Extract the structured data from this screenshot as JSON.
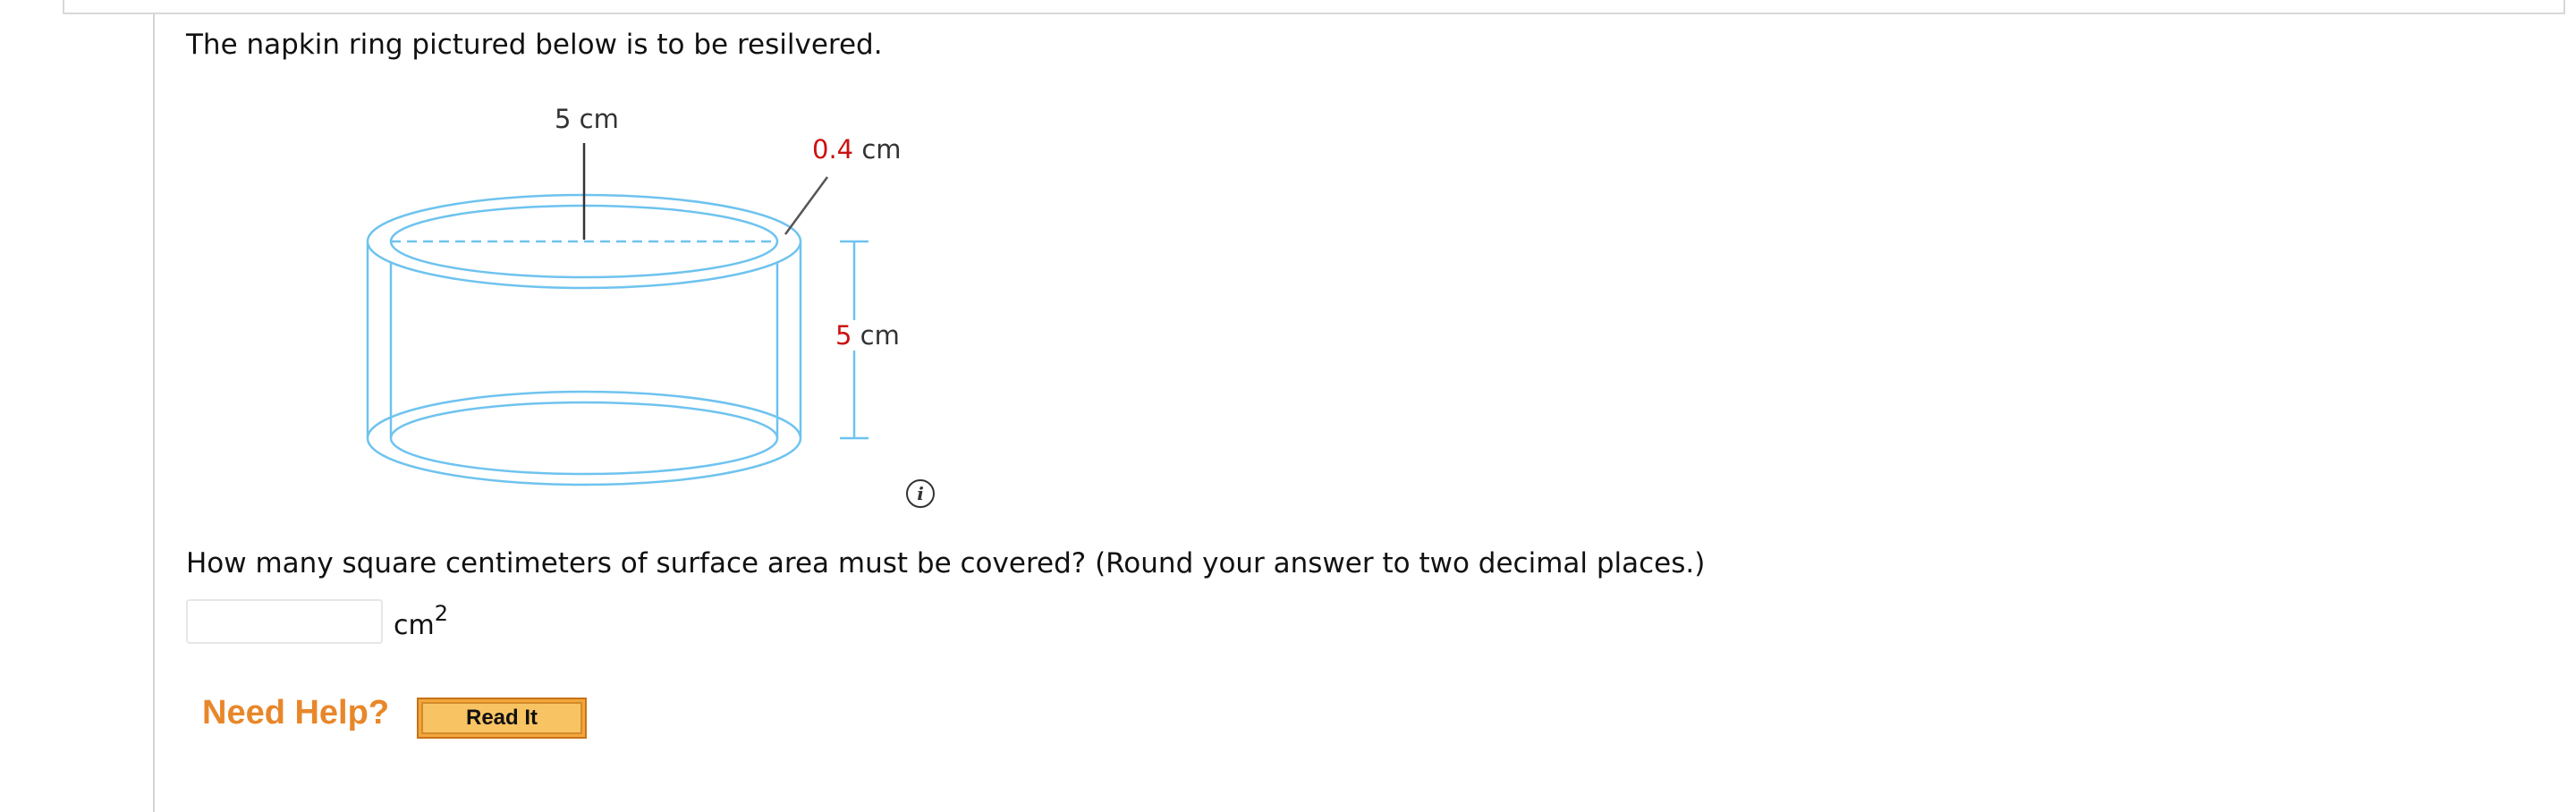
{
  "question": {
    "intro": "The napkin ring pictured below is to be resilvered.",
    "prompt": "How many square centimeters of surface area must be covered? (Round your answer to two decimal places.)"
  },
  "figure": {
    "diameter_label": "5 cm",
    "thickness_value": "0.4",
    "thickness_unit": " cm",
    "height_value": "5",
    "height_unit": " cm",
    "ring_color": "#6ec3ef",
    "value_color": "#cc1111",
    "info_icon": "info-icon",
    "info_glyph": "i"
  },
  "answer": {
    "value": "",
    "placeholder": "",
    "unit_base": "cm",
    "unit_exp": "2"
  },
  "help": {
    "label": "Need Help?",
    "read_it_label": "Read It"
  }
}
